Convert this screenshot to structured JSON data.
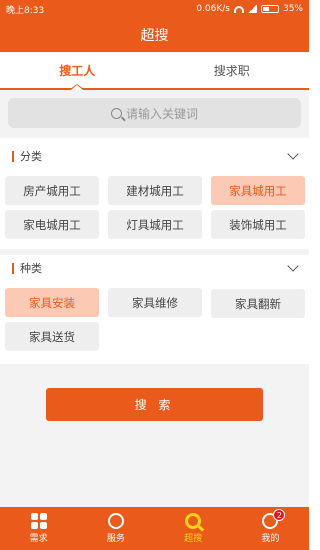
{
  "status": {
    "time": "晚上8:33",
    "speed": "0.06K/s",
    "battery": "35%"
  },
  "title": "超搜",
  "tabs": [
    {
      "label": "搜工人",
      "active": true
    },
    {
      "label": "搜求职",
      "active": false
    }
  ],
  "search": {
    "placeholder": "请输入关键词"
  },
  "category": {
    "label": "分类",
    "options": [
      "房产城用工",
      "建材城用工",
      "家具城用工",
      "家电城用工",
      "灯具城用工",
      "装饰城用工"
    ],
    "selected": "家具城用工"
  },
  "kind": {
    "label": "种类",
    "options": [
      "家具安装",
      "家具维修",
      "家具翻新",
      "家具送货"
    ],
    "selected": "家具安装"
  },
  "search_button": "搜 索",
  "nav": [
    {
      "label": "需求",
      "icon": "grid-icon"
    },
    {
      "label": "服务",
      "icon": "handshake-icon"
    },
    {
      "label": "超搜",
      "icon": "search-icon",
      "active": true
    },
    {
      "label": "我的",
      "icon": "user-icon",
      "badge": "2"
    }
  ],
  "colors": {
    "accent": "#ea5a1a",
    "selected_bg": "#fbc9b4",
    "nav_active": "#ffd11a",
    "badge": "#e8101a"
  }
}
